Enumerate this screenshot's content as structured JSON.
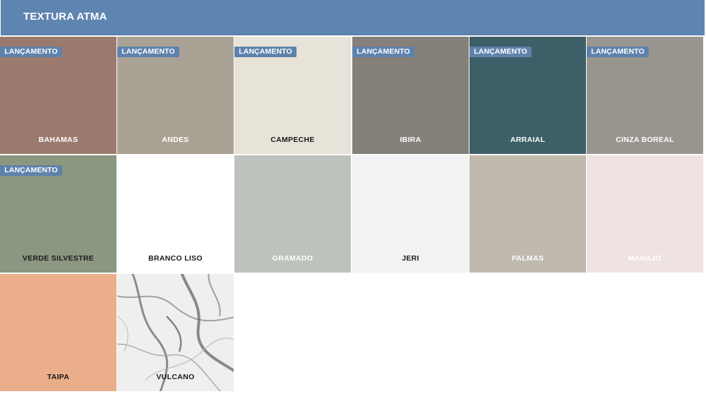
{
  "header": {
    "title": "TEXTURA ATMA"
  },
  "badge_label": "LANÇAMENTO",
  "swatches": [
    {
      "name": "BAHAMAS",
      "color": "#9b7a6d",
      "text_color": "#ffffff",
      "badge": true
    },
    {
      "name": "ANDES",
      "color": "#aaa395",
      "text_color": "#ffffff",
      "badge": true
    },
    {
      "name": "CAMPECHE",
      "color": "#e7e3d8",
      "text_color": "#1a1a1a",
      "badge": true
    },
    {
      "name": "IBIRA",
      "color": "#86807a",
      "text_color": "#ffffff",
      "badge": true
    },
    {
      "name": "ARRAIAL",
      "color": "#3d5f68",
      "text_color": "#ffffff",
      "badge": true
    },
    {
      "name": "CINZA BOREAL",
      "color": "#99958f",
      "text_color": "#ffffff",
      "badge": true
    },
    {
      "name": "VERDE SILVESTRE",
      "color": "#8b9781",
      "text_color": "#1a1a1a",
      "badge": true
    },
    {
      "name": "BRANCO LISO",
      "color": "#ffffff",
      "text_color": "#1a1a1a",
      "badge": false
    },
    {
      "name": "GRAMADO",
      "color": "#bdc2bd",
      "text_color": "#ffffff",
      "badge": false
    },
    {
      "name": "JERI",
      "color": "#f2f2f2",
      "text_color": "#1a1a1a",
      "badge": false
    },
    {
      "name": "PALMAS",
      "color": "#bfb9ae",
      "text_color": "#ffffff",
      "badge": false
    },
    {
      "name": "MARAJÓ",
      "color": "#efe2e2",
      "text_color": "#ffffff",
      "badge": false
    },
    {
      "name": "TAIPA",
      "color": "#eaae8a",
      "text_color": "#1a1a1a",
      "badge": false
    },
    {
      "name": "VULCANO",
      "color": "#eeeeee",
      "text_color": "#1a1a1a",
      "badge": false,
      "pattern": "marble"
    }
  ]
}
